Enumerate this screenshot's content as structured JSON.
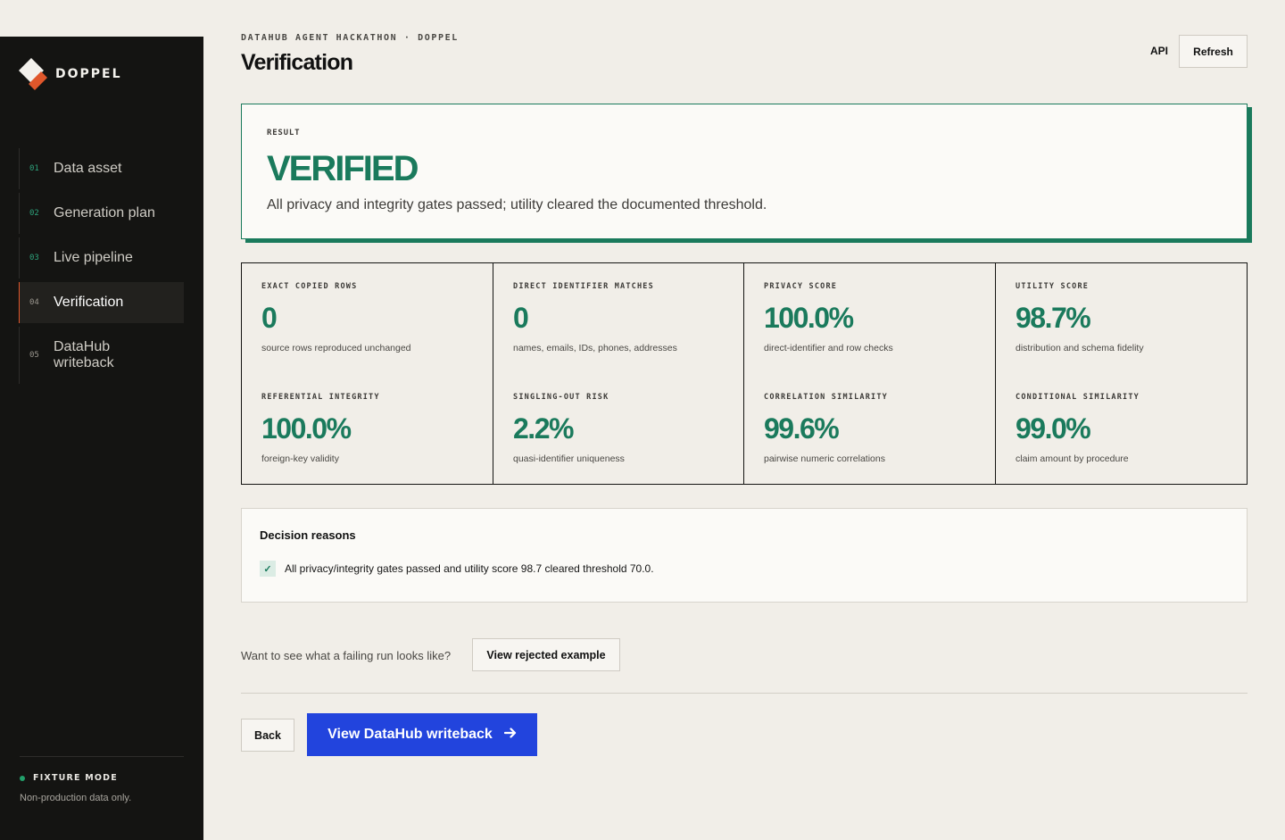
{
  "brand": {
    "name": "DOPPEL"
  },
  "sidebar": {
    "items": [
      {
        "num": "01",
        "label": "Data asset"
      },
      {
        "num": "02",
        "label": "Generation plan"
      },
      {
        "num": "03",
        "label": "Live pipeline"
      },
      {
        "num": "04",
        "label": "Verification"
      },
      {
        "num": "05",
        "label": "DataHub writeback"
      }
    ],
    "mode_label": "FIXTURE MODE",
    "mode_note": "Non-production data only."
  },
  "header": {
    "eyebrow": "DATAHUB AGENT HACKATHON · DOPPEL",
    "title": "Verification",
    "api_label": "API",
    "refresh_label": "Refresh"
  },
  "result": {
    "label": "RESULT",
    "value": "VERIFIED",
    "description": "All privacy and integrity gates passed; utility cleared the documented threshold."
  },
  "metrics": [
    {
      "label": "EXACT COPIED ROWS",
      "value": "0",
      "desc": "source rows reproduced unchanged"
    },
    {
      "label": "DIRECT IDENTIFIER MATCHES",
      "value": "0",
      "desc": "names, emails, IDs, phones, addresses"
    },
    {
      "label": "PRIVACY SCORE",
      "value": "100.0%",
      "desc": "direct-identifier and row checks"
    },
    {
      "label": "UTILITY SCORE",
      "value": "98.7%",
      "desc": "distribution and schema fidelity"
    },
    {
      "label": "REFERENTIAL INTEGRITY",
      "value": "100.0%",
      "desc": "foreign-key validity"
    },
    {
      "label": "SINGLING-OUT RISK",
      "value": "2.2%",
      "desc": "quasi-identifier uniqueness"
    },
    {
      "label": "CORRELATION SIMILARITY",
      "value": "99.6%",
      "desc": "pairwise numeric correlations"
    },
    {
      "label": "CONDITIONAL SIMILARITY",
      "value": "99.0%",
      "desc": "claim amount by procedure"
    }
  ],
  "reasons": {
    "title": "Decision reasons",
    "items": [
      {
        "text": "All privacy/integrity gates passed and utility score 98.7 cleared threshold 70.0."
      }
    ]
  },
  "failing": {
    "prompt": "Want to see what a failing run looks like?",
    "button_label": "View rejected example"
  },
  "footer": {
    "back_label": "Back",
    "primary_label": "View DataHub writeback"
  },
  "colors": {
    "accent_green": "#1a7a5c",
    "primary_blue": "#2244dd",
    "brand_orange": "#e0572b",
    "sidebar_bg": "#141412",
    "page_bg": "#f1eee8"
  },
  "icons": {
    "brand": "doppel-logo-icon",
    "check": "check-icon",
    "arrow": "arrow-right-icon",
    "mode": "status-dot-icon"
  }
}
